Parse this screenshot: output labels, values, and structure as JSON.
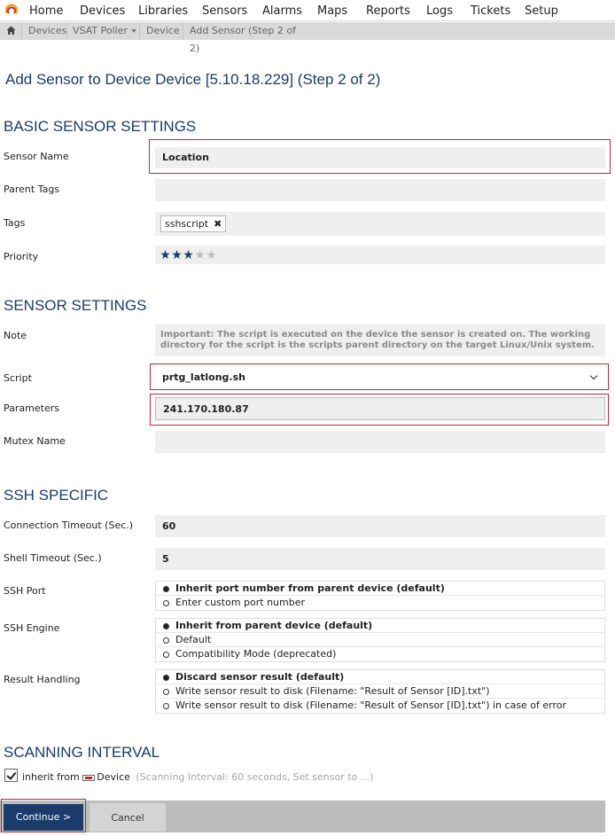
{
  "nav": {
    "menu": [
      "Home",
      "Devices",
      "Libraries",
      "Sensors",
      "Alarms",
      "Maps",
      "Reports",
      "Logs",
      "Tickets",
      "Setup"
    ]
  },
  "breadcrumb": {
    "items": [
      "Devices",
      "VSAT Poller",
      "Device",
      "Add Sensor (Step 2 of 2)"
    ]
  },
  "page": {
    "title": "Add Sensor to Device Device [5.10.18.229]  (Step 2 of 2)"
  },
  "basic": {
    "heading": "BASIC SENSOR SETTINGS",
    "sensor_name_label": "Sensor Name",
    "sensor_name_value": "Location",
    "parent_tags_label": "Parent Tags",
    "parent_tags_value": "",
    "tags_label": "Tags",
    "tag_chip": "sshscript",
    "priority_label": "Priority",
    "priority_value": 3,
    "priority_max": 5
  },
  "sensor": {
    "heading": "SENSOR SETTINGS",
    "note_label": "Note",
    "note_text": "Important: The script is executed on the device the sensor is created on. The working directory for the script is the scripts parent directory on the target Linux/Unix system.",
    "script_label": "Script",
    "script_value": "prtg_latlong.sh",
    "parameters_label": "Parameters",
    "parameters_value": "241.170.180.87",
    "mutex_label": "Mutex Name",
    "mutex_value": ""
  },
  "ssh": {
    "heading": "SSH SPECIFIC",
    "conn_timeout_label": "Connection Timeout (Sec.)",
    "conn_timeout_value": "60",
    "shell_timeout_label": "Shell Timeout (Sec.)",
    "shell_timeout_value": "5",
    "port_label": "SSH Port",
    "port_options": [
      "Inherit port number from parent device (default)",
      "Enter custom port number"
    ],
    "engine_label": "SSH Engine",
    "engine_options": [
      "Inherit from parent device (default)",
      "Default",
      "Compatibility Mode (deprecated)"
    ],
    "result_label": "Result Handling",
    "result_options": [
      "Discard sensor result (default)",
      "Write sensor result to disk (Filename: \"Result of Sensor [ID].txt\")",
      "Write sensor result to disk (Filename: \"Result of Sensor [ID].txt\") in case of error"
    ]
  },
  "scanning": {
    "heading": "SCANNING INTERVAL",
    "inherit_label": "inherit from",
    "device_label": "Device",
    "interval_hint": "(Scanning Interval: 60 seconds, Set sensor to ...)"
  },
  "footer": {
    "continue_label": "Continue >",
    "cancel_label": "Cancel"
  },
  "colors": {
    "accent": "#1b3c6b",
    "highlight": "#c0282e"
  }
}
